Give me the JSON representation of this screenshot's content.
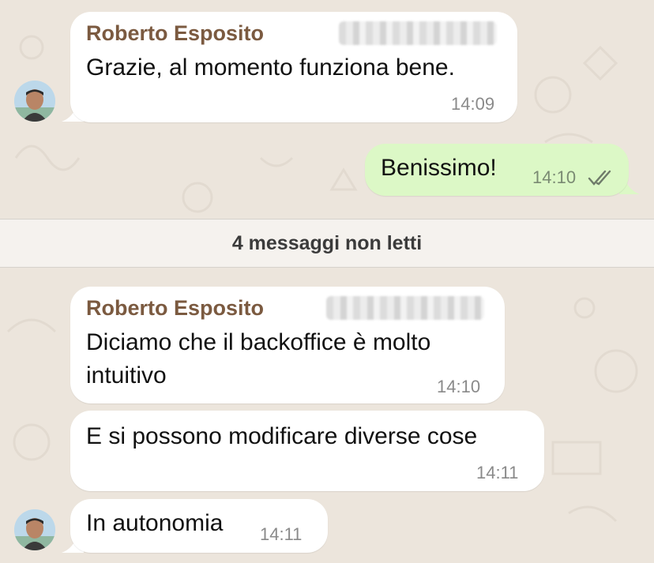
{
  "colors": {
    "background": "#ece5dc",
    "incoming_bubble": "#ffffff",
    "outgoing_bubble": "#dcf8c6",
    "sender_name": "#7b5a40",
    "timestamp": "#8a8a8a"
  },
  "messages": [
    {
      "direction": "incoming",
      "sender": "Roberto Esposito",
      "text": "Grazie, al momento funziona bene.",
      "time": "14:09"
    },
    {
      "direction": "outgoing",
      "text": "Benissimo!",
      "time": "14:10",
      "status_icon": "double-check-icon"
    },
    {
      "direction": "incoming",
      "sender": "Roberto Esposito",
      "text": "Diciamo che il backoffice è molto intuitivo",
      "time": "14:10"
    },
    {
      "direction": "incoming",
      "text": "E si possono modificare diverse cose",
      "time": "14:11"
    },
    {
      "direction": "incoming",
      "text": "In autonomia",
      "time": "14:11"
    }
  ],
  "unread_divider": {
    "label": "4 messaggi non letti"
  }
}
